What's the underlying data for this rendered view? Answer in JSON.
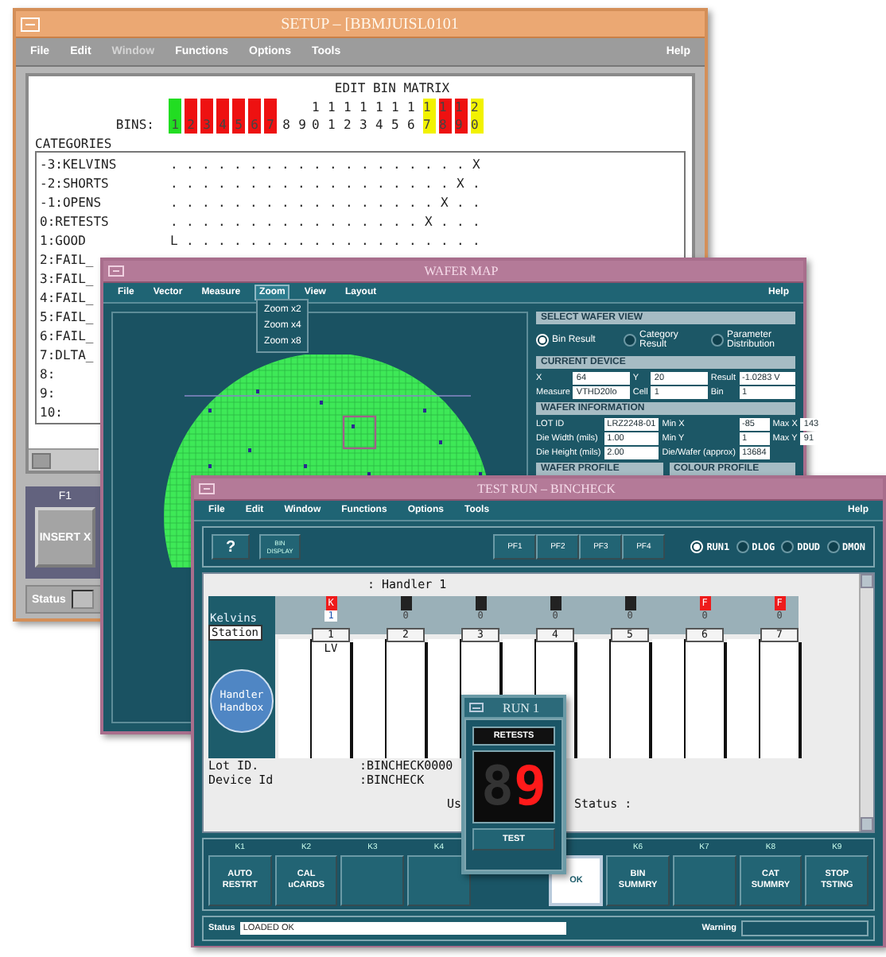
{
  "setup_window": {
    "title": "SETUP – [BBMJUISL0101",
    "menu": [
      {
        "label": "File",
        "disabled": false
      },
      {
        "label": "Edit",
        "disabled": false
      },
      {
        "label": "Window",
        "disabled": true
      },
      {
        "label": "Functions",
        "disabled": false
      },
      {
        "label": "Options",
        "disabled": false
      },
      {
        "label": "Tools",
        "disabled": false
      }
    ],
    "help_menu": "Help",
    "matrix_title": "EDIT BIN MATRIX",
    "bins_label": "BINS:",
    "bins": [
      {
        "label": "1",
        "color": "#22dd22"
      },
      {
        "label": "2",
        "color": "#ee1111"
      },
      {
        "label": "3",
        "color": "#ee1111"
      },
      {
        "label": "4",
        "color": "#ee1111"
      },
      {
        "label": "5",
        "color": "#ee1111"
      },
      {
        "label": "6",
        "color": "#ee1111"
      },
      {
        "label": "7",
        "color": "#ee1111"
      },
      {
        "label": "8"
      },
      {
        "label": "9"
      },
      {
        "label": "10"
      },
      {
        "label": "11"
      },
      {
        "label": "12"
      },
      {
        "label": "13"
      },
      {
        "label": "14"
      },
      {
        "label": "15"
      },
      {
        "label": "16"
      },
      {
        "label": "17",
        "color": "#f2f200"
      },
      {
        "label": "18",
        "color": "#ee1111"
      },
      {
        "label": "19",
        "color": "#ee1111"
      },
      {
        "label": "20",
        "color": "#f2f200"
      }
    ],
    "categories_label": "CATEGORIES",
    "categories": [
      {
        "label": "-3:KELVINS",
        "cells": "...................X"
      },
      {
        "label": "-2:SHORTS",
        "cells": "..................X."
      },
      {
        "label": "-1:OPENS",
        "cells": ".................X.."
      },
      {
        "label": "0:RETESTS",
        "cells": "................X..."
      },
      {
        "label": "1:GOOD",
        "cells": "L..................."
      },
      {
        "label": "2:FAIL_"
      },
      {
        "label": "3:FAIL_"
      },
      {
        "label": "4:FAIL_"
      },
      {
        "label": "5:FAIL_"
      },
      {
        "label": "6:FAIL_"
      },
      {
        "label": "7:DLTA_"
      },
      {
        "label": "8:"
      },
      {
        "label": "9:"
      },
      {
        "label": "10:"
      }
    ],
    "function_key": {
      "key": "F1",
      "label": "INSERT X"
    },
    "status_label": "Status"
  },
  "wafer_window": {
    "title": "WAFER MAP",
    "menu": [
      {
        "label": "File",
        "selected": false
      },
      {
        "label": "Vector",
        "selected": false
      },
      {
        "label": "Measure",
        "selected": false
      },
      {
        "label": "Zoom",
        "selected": true,
        "items": [
          "Zoom x2",
          "Zoom x4",
          "Zoom x8"
        ]
      },
      {
        "label": "View",
        "selected": false
      },
      {
        "label": "Layout",
        "selected": false
      }
    ],
    "help_menu": "Help",
    "view_header": "SELECT WAFER VIEW",
    "views": [
      {
        "label": "Bin Result",
        "selected": true
      },
      {
        "label": "Category Result",
        "selected": false
      },
      {
        "label": "Parameter Distribution",
        "selected": false
      }
    ],
    "device_header": "CURRENT DEVICE",
    "device_fields": [
      {
        "label": "X",
        "value": "64"
      },
      {
        "label": "Y",
        "value": "20"
      },
      {
        "label": "Result",
        "value": "-1.0283 V"
      },
      {
        "label": "Measure",
        "value": "VTHD20lo"
      },
      {
        "label": "Cell",
        "value": "1"
      },
      {
        "label": "Bin",
        "value": "1"
      }
    ],
    "info_header": "WAFER INFORMATION",
    "info_fields": [
      {
        "label": "LOT ID",
        "value": "LRZ2248-01"
      },
      {
        "label": "Min X",
        "value": "-85"
      },
      {
        "label": "Max X",
        "value": "143"
      },
      {
        "label": "Die Width (mils)",
        "value": "1.00"
      },
      {
        "label": "Min Y",
        "value": "1"
      },
      {
        "label": "Max Y",
        "value": "91"
      },
      {
        "label": "Die Height (mils)",
        "value": "2.00"
      },
      {
        "label": "Die/Wafer (approx)",
        "value": "13684"
      }
    ],
    "profile_headers": [
      "WAFER PROFILE",
      "COLOUR PROFILE"
    ]
  },
  "test_run_window": {
    "title": "TEST RUN – BINCHECK",
    "menu": [
      "File",
      "Edit",
      "Window",
      "Functions",
      "Options",
      "Tools"
    ],
    "help_menu": "Help",
    "help_button": "?",
    "details_button": "BIN DISPLAY",
    "pf_buttons": [
      "PF1",
      "PF2",
      "PF3",
      "PF4"
    ],
    "modes": [
      {
        "label": "RUN1",
        "selected": true
      },
      {
        "label": "DLOG",
        "selected": false
      },
      {
        "label": "DDUD",
        "selected": false
      },
      {
        "label": "DMON",
        "selected": false
      }
    ],
    "handler": ": Handler 1",
    "station_labels": [
      "Kelvins",
      "Station"
    ],
    "handbox": "Handler Handbox",
    "stations": [
      {
        "number": "1",
        "failed": true,
        "flag": "K",
        "count": "1",
        "selected": true,
        "note": "LV"
      },
      {
        "number": "2",
        "failed": false,
        "count": "0",
        "selected": false
      },
      {
        "number": "3",
        "failed": false,
        "count": "0",
        "selected": false
      },
      {
        "number": "4",
        "failed": false,
        "count": "0",
        "selected": false
      },
      {
        "number": "5",
        "failed": false,
        "count": "0",
        "selected": false
      },
      {
        "number": "6",
        "failed": true,
        "flag": "F",
        "count": "0",
        "selected": false
      },
      {
        "number": "7",
        "failed": true,
        "flag": "F",
        "count": "0",
        "selected": false
      }
    ],
    "lot_label": "Lot ID.",
    "lot_value": ":BINCHECK0000",
    "device_label": "Device Id",
    "device_value": ":BINCHECK",
    "user_label": "Us",
    "run_status_label": "Status :",
    "keys": [
      {
        "key": "K1",
        "label": "AUTO RESTRT",
        "pressed": false
      },
      {
        "key": "K2",
        "label": "CAL uCARDS",
        "pressed": false
      },
      {
        "key": "K3",
        "pressed": false
      },
      {
        "key": "K4",
        "pressed": false
      },
      {
        "label": "OK",
        "pressed": true
      },
      {
        "key": "K6",
        "label": "BIN SUMMRY",
        "pressed": false
      },
      {
        "key": "K7",
        "pressed": false
      },
      {
        "key": "K8",
        "label": "CAT SUMMRY",
        "pressed": false
      },
      {
        "key": "K9",
        "label": "STOP TSTING",
        "pressed": false
      }
    ],
    "status_label": "Status",
    "status_value": "LOADED OK",
    "warning_label": "Warning"
  },
  "run_popup": {
    "title": "RUN 1",
    "counter_label": "RETESTS",
    "digits": [
      {
        "value": "8",
        "lit": false
      },
      {
        "value": "9",
        "lit": true
      }
    ],
    "button": "TEST"
  }
}
